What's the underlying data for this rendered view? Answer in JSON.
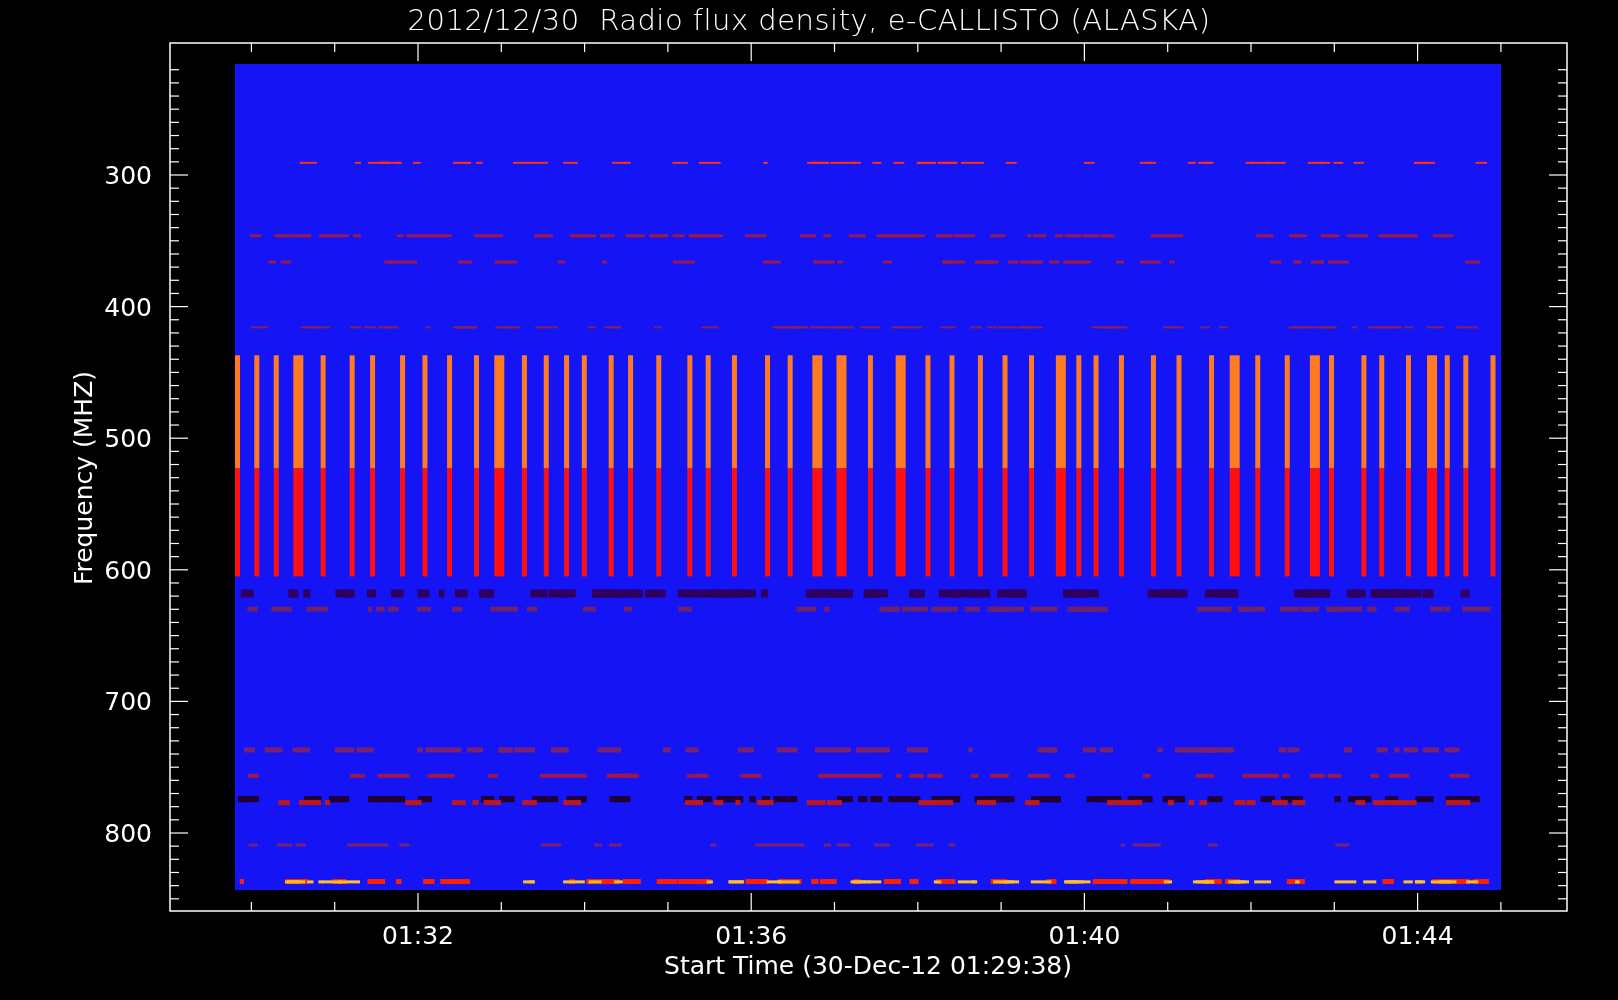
{
  "title": "2012/12/30  Radio flux density, e-CALLISTO (ALASKA)",
  "y_axis": {
    "label": "Frequency (MHZ)",
    "ticks": [
      "300",
      "400",
      "500",
      "600",
      "700",
      "800"
    ]
  },
  "x_axis": {
    "label": "Start Time (30-Dec-12 01:29:38)",
    "ticks": [
      "01:32",
      "01:36",
      "01:40",
      "01:44"
    ]
  }
}
